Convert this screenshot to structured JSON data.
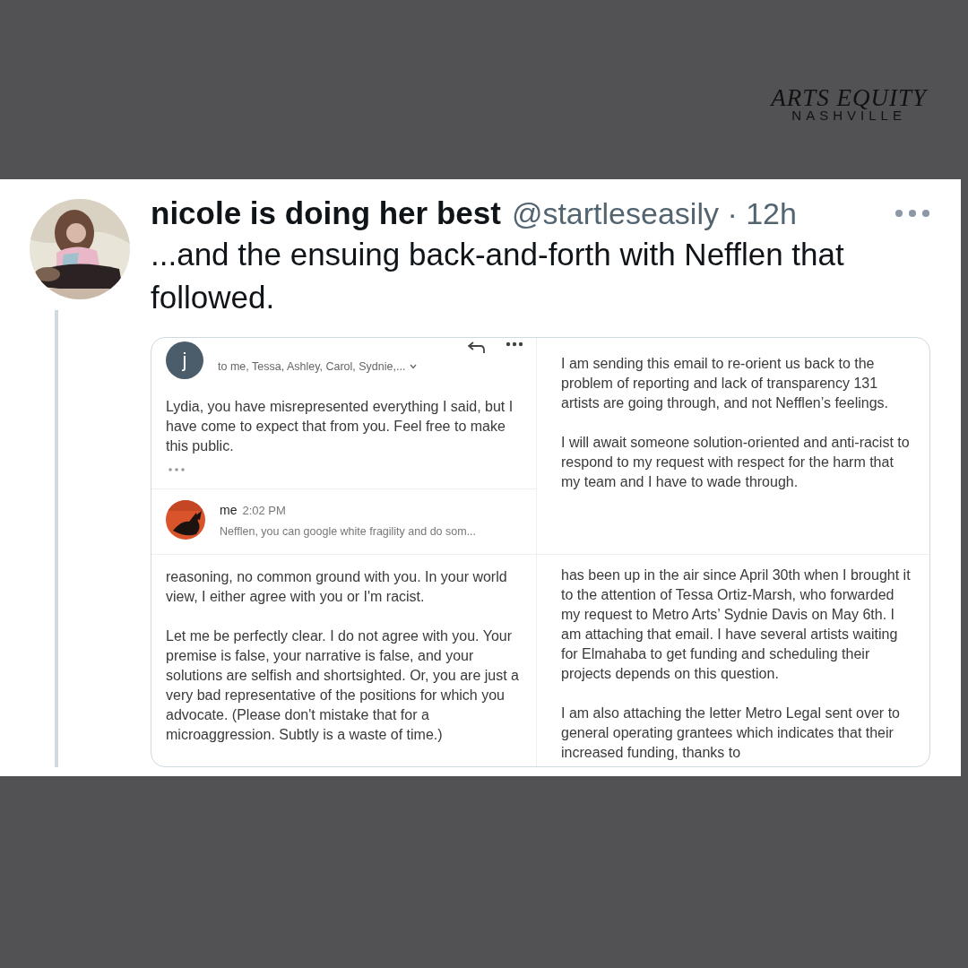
{
  "logo": {
    "title": "ARTS EQUITY",
    "subtitle": "NASHVILLE"
  },
  "tweet": {
    "author": "nicole is doing her best",
    "meta": "@startleseasily · 12h",
    "text": "...and the ensuing back-and-forth with Nefflen that followed.",
    "attachment": {
      "email": {
        "avatar_letter": "j",
        "recipients": "to me, Tessa, Ashley, Carol, Sydnie,...",
        "body": "Lydia, you have misrepresented everything I said, but I have come to expect that from you. Feel free to make this public.",
        "reply": {
          "sender": "me",
          "time": "2:02 PM",
          "snippet": "Nefflen, you can google white fragility and do som..."
        }
      },
      "right_top": [
        "I am sending this email to re-orient us back to the problem of reporting and lack of transparency 131 artists are going through, and not Nefflen’s feelings.",
        "I will await someone solution-oriented and anti-racist to respond to my request with respect for the harm that my team and I have to wade through."
      ],
      "left_bottom": [
        "reasoning, no common ground with you.  In your world view, I either  agree with you or I'm racist.",
        "Let me be perfectly clear. I do not agree with you. Your premise is false, your narrative is false, and your solutions are selfish and shortsighted. Or, you are just a very bad representative of the positions for which you advocate. (Please don't mistake that for a microaggression. Subtly is a waste of time.)"
      ],
      "right_bottom": [
        "has been up in the air since April 30th when I brought it to the attention of Tessa Ortiz-Marsh, who forwarded my request to Metro Arts’ Sydnie Davis on May 6th. I am attaching that email. I have several artists waiting for Elmahaba to get funding and scheduling their projects depends on this question.",
        "I am also attaching the letter Metro Legal sent over to general operating grantees which indicates that their increased funding, thanks to"
      ]
    }
  }
}
